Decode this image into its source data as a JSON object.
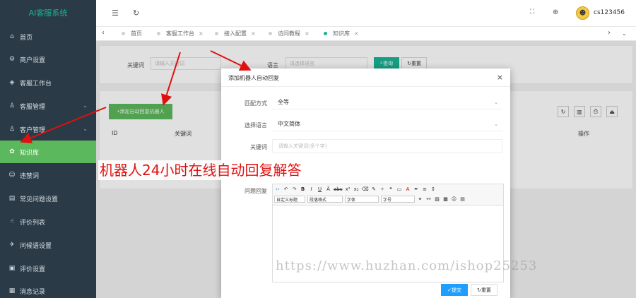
{
  "app": {
    "title": "AI客服系统"
  },
  "sidebar": {
    "items": [
      {
        "label": "首页",
        "icon": "home-icon"
      },
      {
        "label": "商户设置",
        "icon": "gear-icon"
      },
      {
        "label": "客服工作台",
        "icon": "console-icon"
      },
      {
        "label": "客服管理",
        "icon": "user-icon",
        "caret": "⌄"
      },
      {
        "label": "客户管理",
        "icon": "customer-icon",
        "caret": "⌄"
      },
      {
        "label": "知识库",
        "icon": "knowledge-icon",
        "active": true
      },
      {
        "label": "违禁词",
        "icon": "forbidden-icon"
      },
      {
        "label": "常见问题设置",
        "icon": "faq-icon"
      },
      {
        "label": "评价列表",
        "icon": "thumb-icon"
      },
      {
        "label": "问候语设置",
        "icon": "greeting-icon"
      },
      {
        "label": "评价设置",
        "icon": "rating-settings-icon"
      },
      {
        "label": "消息记录",
        "icon": "message-icon"
      }
    ]
  },
  "header": {
    "username": "cs123456"
  },
  "tabs": [
    {
      "label": "首页"
    },
    {
      "label": "客服工作台"
    },
    {
      "label": "接入配置"
    },
    {
      "label": "访问教程"
    },
    {
      "label": "知识库",
      "active": true
    }
  ],
  "search": {
    "keyword_label": "关键词",
    "keyword_placeholder": "请输入关键词",
    "language_label": "语言",
    "language_placeholder": "请选择语言",
    "search_button": "查询",
    "reset_button": "重置"
  },
  "toolbar": {
    "add_button": "+添加自动回复机器人"
  },
  "table": {
    "headers": [
      "ID",
      "关键词",
      "操作"
    ]
  },
  "modal": {
    "title": "添加机器人自动回复",
    "match_label": "匹配方式",
    "match_value": "全等",
    "language_label": "选择语言",
    "language_value": "中文简体",
    "keyword_label": "关键词",
    "keyword_placeholder": "请输入关键词(多个字)",
    "answer_label": "问题回复",
    "editor": {
      "custom_title": "自定义标题",
      "paragraph": "段落格式",
      "font": "字体",
      "size": "字号"
    },
    "submit_button": "提交",
    "reset_button": "重置"
  },
  "annotation": {
    "banner": "机器人24小时在线自动回复解答"
  },
  "watermark": "https://www.huzhan.com/ishop25253",
  "colors": {
    "sidebar_bg": "#2a3b47",
    "active_green": "#5cb85c",
    "accent": "#1ab394",
    "submit_blue": "#1e9fff",
    "annotation_red": "#e01010"
  }
}
